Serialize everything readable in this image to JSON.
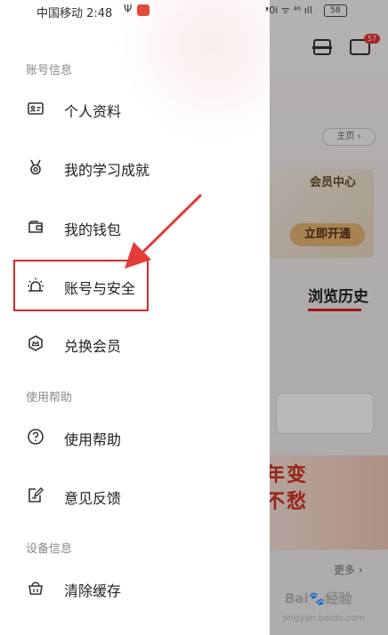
{
  "status_bar": {
    "carrier_time": "中国移动 2:48",
    "usb_symbol": "Ψ",
    "right_indicators": "ᵜ0ⅰ ᯤ ⁴⁶ ıll",
    "battery": "58"
  },
  "background": {
    "mail_badge": "57",
    "home_pill": "主页 ›",
    "vip_title": "会员中心",
    "vip_button": "立即开通",
    "history_tab": "浏览历史",
    "banner_text_1": "年变",
    "banner_text_2": "不愁",
    "more_link": "更多 ›",
    "watermark": "Bai🐾经验",
    "watermark_sub": "jingyan.baidu.com"
  },
  "drawer": {
    "account_section": "账号信息",
    "account_items": [
      {
        "label": "个人资料",
        "icon": "id-card-icon"
      },
      {
        "label": "我的学习成就",
        "icon": "medal-icon"
      },
      {
        "label": "我的钱包",
        "icon": "wallet-icon"
      },
      {
        "label": "账号与安全",
        "icon": "alarm-light-icon"
      },
      {
        "label": "兑换会员",
        "icon": "crown-shield-icon"
      }
    ],
    "help_section": "使用帮助",
    "help_items": [
      {
        "label": "使用帮助",
        "icon": "question-circle-icon"
      },
      {
        "label": "意见反馈",
        "icon": "feedback-edit-icon"
      }
    ],
    "device_section": "设备信息",
    "device_items": [
      {
        "label": "清除缓存",
        "icon": "broom-basket-icon"
      }
    ]
  },
  "colors": {
    "annotation_red": "#d82a2a",
    "drawer_bg": "#ffffff",
    "section_gray": "#888888"
  }
}
